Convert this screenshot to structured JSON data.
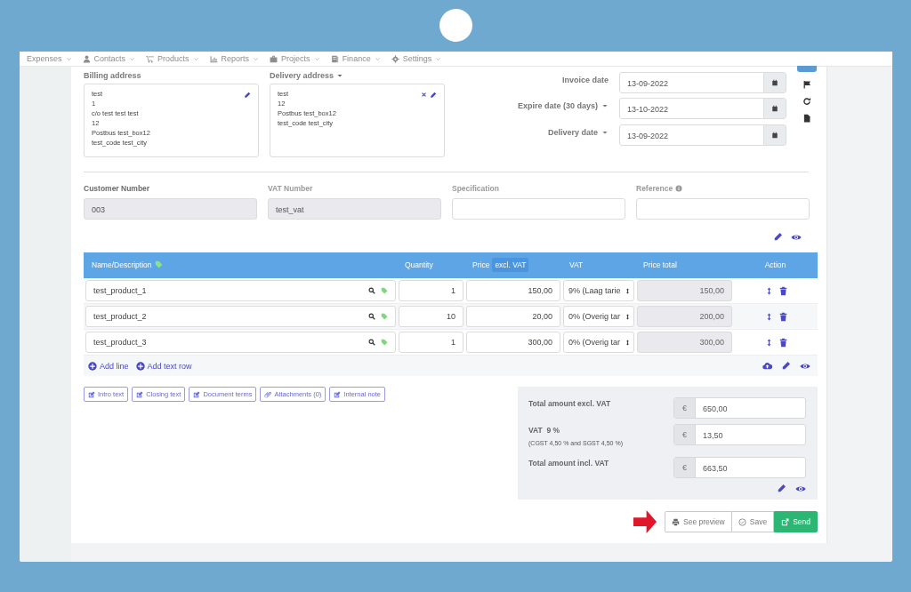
{
  "nav": [
    {
      "label": "Expenses",
      "kind": "none"
    },
    {
      "label": "Contacts",
      "kind": "user"
    },
    {
      "label": "Products",
      "kind": "cart"
    },
    {
      "label": "Reports",
      "kind": "chart"
    },
    {
      "label": "Projects",
      "kind": "briefcase"
    },
    {
      "label": "Finance",
      "kind": "book"
    },
    {
      "label": "Settings",
      "kind": "gear"
    }
  ],
  "billing_address": {
    "label": "Billing address",
    "dropdown": false,
    "removable": false,
    "lines": [
      "test",
      "1",
      "c/o test test test",
      "12",
      "Postbus test_box12",
      "test_code test_city"
    ]
  },
  "delivery_address": {
    "label": "Delivery address",
    "dropdown": true,
    "removable": true,
    "lines": [
      "test",
      "12",
      "Postbus test_box12",
      "test_code test_city"
    ]
  },
  "dates": [
    {
      "label": "Invoice date",
      "dropdown": false,
      "value": "13-09-2022"
    },
    {
      "label": "Expire date (30 days)",
      "dropdown": true,
      "value": "13-10-2022"
    },
    {
      "label": "Delivery date",
      "dropdown": true,
      "value": "13-09-2022"
    }
  ],
  "fields": [
    {
      "label": "Customer Number",
      "value": "003",
      "disabled": true,
      "info": false
    },
    {
      "label": "VAT Number",
      "value": "test_vat",
      "disabled": true,
      "info": false
    },
    {
      "label": "Specification",
      "disabled": false,
      "info": false
    },
    {
      "label": "Reference",
      "disabled": false,
      "info": true
    }
  ],
  "table": {
    "columns": [
      {
        "label": "Name/Description"
      },
      {
        "label": "Quantity"
      },
      {
        "label": "Price",
        "badge": "excl. VAT"
      },
      {
        "label": "VAT"
      },
      {
        "label": "Price total"
      },
      {
        "label": "Action"
      }
    ],
    "rows": [
      {
        "name": "test_product_1",
        "quantity": "1",
        "price": "150,00",
        "vat": "9% (Laag tarie",
        "total": "150,00"
      },
      {
        "name": "test_product_2",
        "quantity": "10",
        "price": "20,00",
        "vat": "0% (Overig tar",
        "total": "200,00"
      },
      {
        "name": "test_product_3",
        "quantity": "1",
        "price": "300,00",
        "vat": "0% (Overig tar",
        "total": "300,00"
      }
    ],
    "add_buttons": [
      "Add line",
      "Add text row"
    ]
  },
  "text_buttons": [
    {
      "label": "Intro text",
      "kind": "edit"
    },
    {
      "label": "Closing text",
      "kind": "edit"
    },
    {
      "label": "Document terms",
      "kind": "edit"
    },
    {
      "label": "Attachments (0)",
      "kind": "attach"
    },
    {
      "label": "Internal note",
      "kind": "edit"
    }
  ],
  "totals": [
    {
      "label": "Total amount excl. VAT",
      "currency": "€",
      "value": "650,00"
    },
    {
      "label": "VAT  9 %",
      "note": "(CGST 4,50 % and SGST 4,50 %)",
      "currency": "€",
      "value": "13,50"
    },
    {
      "label": "Total amount incl. VAT",
      "currency": "€",
      "value": "663,50"
    }
  ],
  "actions": [
    {
      "label": "See preview",
      "kind": "print"
    },
    {
      "label": "Save",
      "kind": "save"
    },
    {
      "label": "Send",
      "kind": "send"
    }
  ]
}
